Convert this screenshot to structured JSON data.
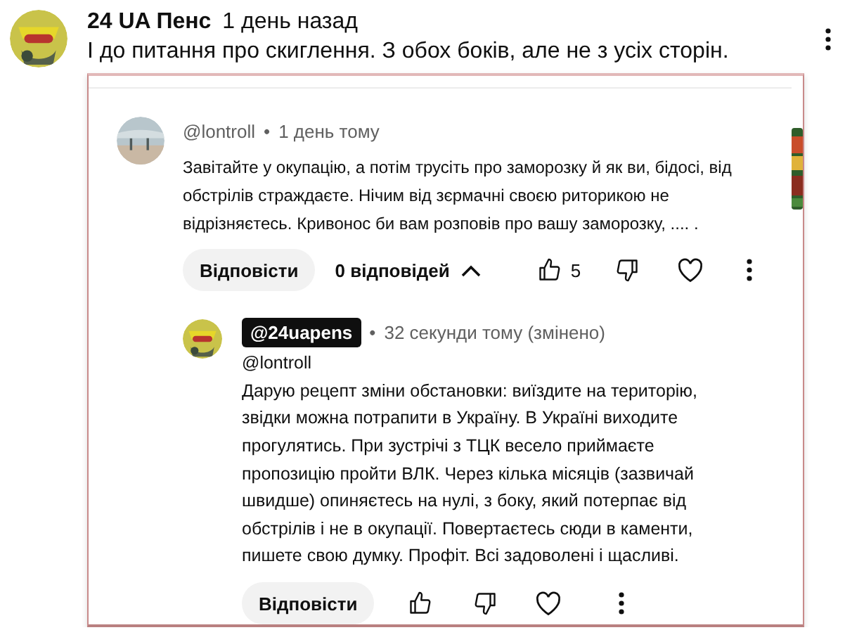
{
  "comment": {
    "author": "24 UA Пенс",
    "time": "1 день назад",
    "text": "І до питання про скиглення. З обох боків, але не з усіх сторін."
  },
  "screenshot": {
    "comment": {
      "handle": "@lontroll",
      "owner": false,
      "separator": "•",
      "time": "1 день тому",
      "lines": [
        "Завітайте у окупацію, а потім трусіть про заморозку й як ви, бідосі, від",
        "обстрілів страждаєте. Нічим від зєрмачні своєю риторикою не",
        "відрізняєтесь. Кривонос би вам розповів про вашу заморозку,  .... ."
      ],
      "reply_button": "Відповісти",
      "replies_toggle": "0 відповідей",
      "expanded": true,
      "likes": "5"
    },
    "reply": {
      "handle": "@24uapens",
      "owner": true,
      "separator": "•",
      "time": "32 секунди тому (змінено)",
      "lines": [
        "@lontroll",
        "Дарую рецепт зміни обстановки: виїздите на територію,",
        "звідки можна потрапити в Україну. В Україні виходите",
        "прогулятись. При зустрічі з ТЦК весело приймаєте",
        "пропозицію пройти ВЛК. Через кілька місяців (зазвичай",
        "швидше) опиняєтесь на нулі, з боку, який потерпає від",
        "обстрілів і не в окупації. Повертаєтесь сюди в каменти,",
        "пишете свою думку. Профіт. Всі задоволені і щасливі."
      ],
      "reply_button": "Відповісти"
    }
  }
}
